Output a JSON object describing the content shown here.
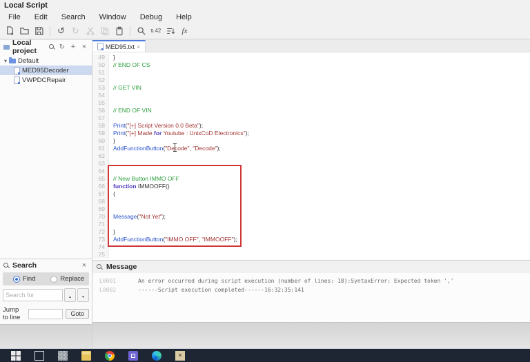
{
  "window": {
    "title": "Local Script"
  },
  "menubar": {
    "items": [
      "File",
      "Edit",
      "Search",
      "Window",
      "Debug",
      "Help"
    ]
  },
  "toolbar": {
    "icons": [
      "new-file-icon",
      "open-folder-icon",
      "save-icon",
      "undo-icon",
      "redo-icon",
      "cut-icon",
      "copy-icon",
      "paste-icon",
      "search-icon",
      "goto-line-icon",
      "sort-lines-icon",
      "function-icon"
    ],
    "goto_glyph": "42",
    "fx_glyph": "fx"
  },
  "sidebar": {
    "header": {
      "title": "Local project"
    },
    "tree": [
      {
        "label": "Default",
        "type": "folder",
        "selected": false
      },
      {
        "label": "MED95Decoder",
        "type": "script",
        "selected": true
      },
      {
        "label": "VWPDCRepair",
        "type": "script",
        "selected": false
      }
    ]
  },
  "tabbar": {
    "tabs": [
      {
        "label": "MED95.txt",
        "active": true
      }
    ]
  },
  "editor": {
    "lines": [
      {
        "n": 49,
        "tokens": [
          {
            "t": "}",
            "c": "pl"
          }
        ]
      },
      {
        "n": 50,
        "tokens": [
          {
            "t": "// END OF CS",
            "c": "cm"
          }
        ]
      },
      {
        "n": 51,
        "tokens": []
      },
      {
        "n": 52,
        "tokens": []
      },
      {
        "n": 53,
        "tokens": [
          {
            "t": "// GET VIN",
            "c": "cm"
          }
        ]
      },
      {
        "n": 54,
        "tokens": []
      },
      {
        "n": 55,
        "tokens": []
      },
      {
        "n": 56,
        "tokens": [
          {
            "t": "// END OF VIN",
            "c": "cm"
          }
        ]
      },
      {
        "n": 57,
        "tokens": []
      },
      {
        "n": 58,
        "tokens": [
          {
            "t": "Print",
            "c": "fn"
          },
          {
            "t": "(",
            "c": "pl"
          },
          {
            "t": "\"[+] Script Version 0.0 Beta\"",
            "c": "str"
          },
          {
            "t": ");",
            "c": "pl"
          }
        ]
      },
      {
        "n": 59,
        "tokens": [
          {
            "t": "Print",
            "c": "fn"
          },
          {
            "t": "(",
            "c": "pl"
          },
          {
            "t": "\"[+] Made ",
            "c": "str"
          },
          {
            "t": "for",
            "c": "kw"
          },
          {
            "t": " Youtube : UnixCoD Electronics\"",
            "c": "str"
          },
          {
            "t": ");",
            "c": "pl"
          }
        ]
      },
      {
        "n": 60,
        "tokens": [
          {
            "t": "}",
            "c": "pl"
          }
        ]
      },
      {
        "n": 61,
        "tokens": [
          {
            "t": "AddFunctionButton",
            "c": "fn"
          },
          {
            "t": "(",
            "c": "pl"
          },
          {
            "t": "\"Decode\"",
            "c": "str"
          },
          {
            "t": ", ",
            "c": "pl"
          },
          {
            "t": "\"Decode\"",
            "c": "str"
          },
          {
            "t": ");",
            "c": "pl"
          }
        ]
      },
      {
        "n": 62,
        "tokens": []
      },
      {
        "n": 63,
        "tokens": []
      },
      {
        "n": 64,
        "tokens": []
      },
      {
        "n": 65,
        "tokens": [
          {
            "t": "// New Button IMMO OFF",
            "c": "cm"
          }
        ]
      },
      {
        "n": 66,
        "tokens": [
          {
            "t": "function",
            "c": "kw"
          },
          {
            "t": " IMMOOFF()",
            "c": "pl"
          }
        ]
      },
      {
        "n": 67,
        "tokens": [
          {
            "t": "{",
            "c": "pl"
          }
        ]
      },
      {
        "n": 68,
        "tokens": []
      },
      {
        "n": 69,
        "tokens": []
      },
      {
        "n": 70,
        "tokens": [
          {
            "t": "Message",
            "c": "fn"
          },
          {
            "t": "(",
            "c": "pl"
          },
          {
            "t": "\"Not Yet\"",
            "c": "str"
          },
          {
            "t": ");",
            "c": "pl"
          }
        ]
      },
      {
        "n": 71,
        "tokens": []
      },
      {
        "n": 72,
        "tokens": [
          {
            "t": "}",
            "c": "pl"
          }
        ]
      },
      {
        "n": 73,
        "tokens": [
          {
            "t": "AddFunctionButton",
            "c": "fn"
          },
          {
            "t": "(",
            "c": "pl"
          },
          {
            "t": "\"IMMO OFF\"",
            "c": "str"
          },
          {
            "t": ", ",
            "c": "pl"
          },
          {
            "t": "\"IMMOOFF\"",
            "c": "str"
          },
          {
            "t": ");",
            "c": "pl"
          }
        ]
      },
      {
        "n": 74,
        "tokens": []
      },
      {
        "n": 75,
        "tokens": []
      }
    ]
  },
  "search_panel": {
    "title": "Search",
    "find_label": "Find",
    "replace_label": "Replace",
    "find_selected": true,
    "search_placeholder": "Search for",
    "jump_label": "Jump to line",
    "goto_label": "Goto"
  },
  "message_panel": {
    "title": "Message",
    "rows": [
      {
        "id": "L0001",
        "text": "An error occurred during script execution (number of lines: 18):SyntaxError: Expected token ','"
      },
      {
        "id": "L0002",
        "text": "------Script execution completed------16:32:35:141"
      }
    ]
  },
  "taskbar": {
    "icons": [
      {
        "name": "windows-start-button",
        "cls": "start"
      },
      {
        "name": "task-view-button",
        "cls": "taskview"
      },
      {
        "name": "snipping-tool-button",
        "cls": "snip"
      },
      {
        "name": "file-explorer-button",
        "cls": "explorer"
      },
      {
        "name": "chrome-button",
        "cls": "chrome"
      },
      {
        "name": "script-ide-button",
        "cls": "ide"
      },
      {
        "name": "edge-button",
        "cls": "edge"
      },
      {
        "name": "notes-app-button",
        "cls": "notes"
      }
    ]
  },
  "colors": {
    "tab_accent": "#4c7bd9",
    "selection": "#cdd9ef",
    "annotation_red": "#cf3636",
    "comment_green": "#2e9e3f",
    "function_blue": "#2952cc",
    "string_maroon": "#a13434",
    "keyword_violet": "#4b3bbf",
    "taskbar_bg": "#1e2634"
  }
}
